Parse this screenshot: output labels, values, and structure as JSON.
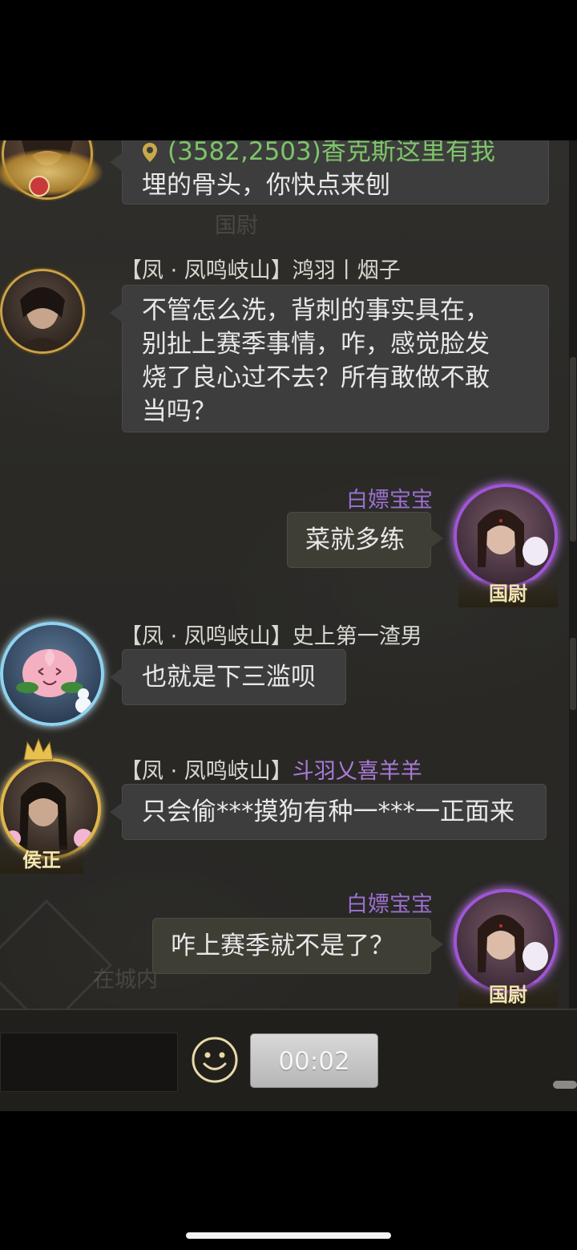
{
  "messages": [
    {
      "id": "m1",
      "line1": "(3582,2503)香克斯这里有我",
      "line2": "埋的骨头，你快点来刨"
    },
    {
      "id": "m2",
      "guild": "【凤 · 凤鸣岐山】",
      "name": "鸿羽丨烟子",
      "lines": [
        "不管怎么洗，背刺的事实具在，",
        "别扯上赛季事情，咋，感觉脸发",
        "烧了良心过不去？所有敢做不敢",
        "当吗？"
      ]
    },
    {
      "id": "m3",
      "name": "白嫖宝宝",
      "text": "菜就多练",
      "title": "国尉"
    },
    {
      "id": "m4",
      "guild": "【凤 · 凤鸣岐山】",
      "name": "史上第一渣男",
      "text": "也就是下三滥呗"
    },
    {
      "id": "m5",
      "guild": "【凤 · 凤鸣岐山】",
      "name": "斗羽乂喜羊羊",
      "text": "只会偷***摸狗有种一***一正面来",
      "title": "侯正"
    },
    {
      "id": "m6",
      "name": "白嫖宝宝",
      "text": "咋上赛季就不是了？",
      "title": "国尉"
    }
  ],
  "background_labels": {
    "label_a": "国尉",
    "label_b": "在城内"
  },
  "input_bar": {
    "voice_timer": "00:02"
  },
  "colors": {
    "bubble_other": "#3d3d3d",
    "bubble_self": "#3f3e35",
    "self_name": "#9a6fd0",
    "coordinate_link": "#7fc46a",
    "purple_name": "#a97ad8"
  }
}
